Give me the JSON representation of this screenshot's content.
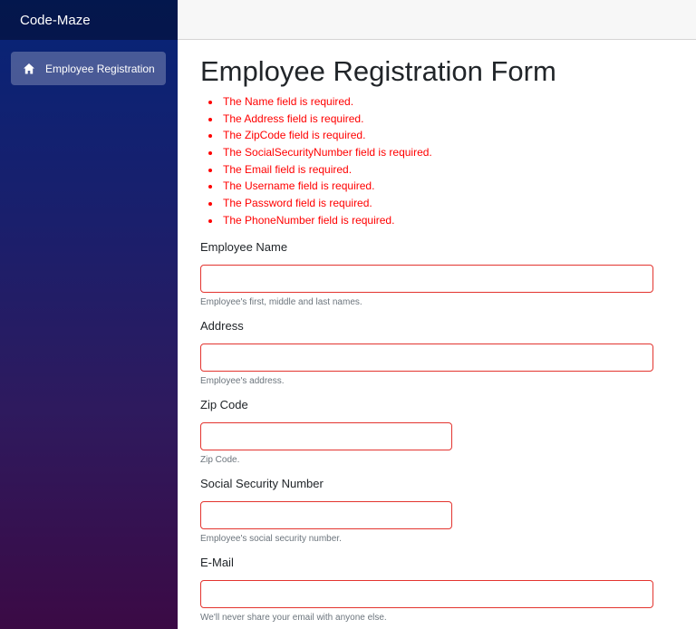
{
  "sidebar": {
    "brand": "Code-Maze",
    "items": [
      {
        "label": "Employee Registration",
        "icon": "home-icon"
      }
    ]
  },
  "main": {
    "title": "Employee Registration Form",
    "errors": [
      "The Name field is required.",
      "The Address field is required.",
      "The ZipCode field is required.",
      "The SocialSecurityNumber field is required.",
      "The Email field is required.",
      "The Username field is required.",
      "The Password field is required.",
      "The PhoneNumber field is required."
    ],
    "fields": [
      {
        "label": "Employee Name",
        "value": "",
        "help": "Employee's first, middle and last names."
      },
      {
        "label": "Address",
        "value": "",
        "help": "Employee's address."
      },
      {
        "label": "Zip Code",
        "value": "",
        "help": "Zip Code."
      },
      {
        "label": "Social Security Number",
        "value": "",
        "help": "Employee's social security number."
      },
      {
        "label": "E-Mail",
        "value": "",
        "help": "We'll never share your email with anyone else."
      }
    ]
  },
  "colors": {
    "error": "#ff0000",
    "invalid_border": "#e3342f",
    "sidebar_top": "#062477",
    "sidebar_bottom": "#3b0a45"
  }
}
